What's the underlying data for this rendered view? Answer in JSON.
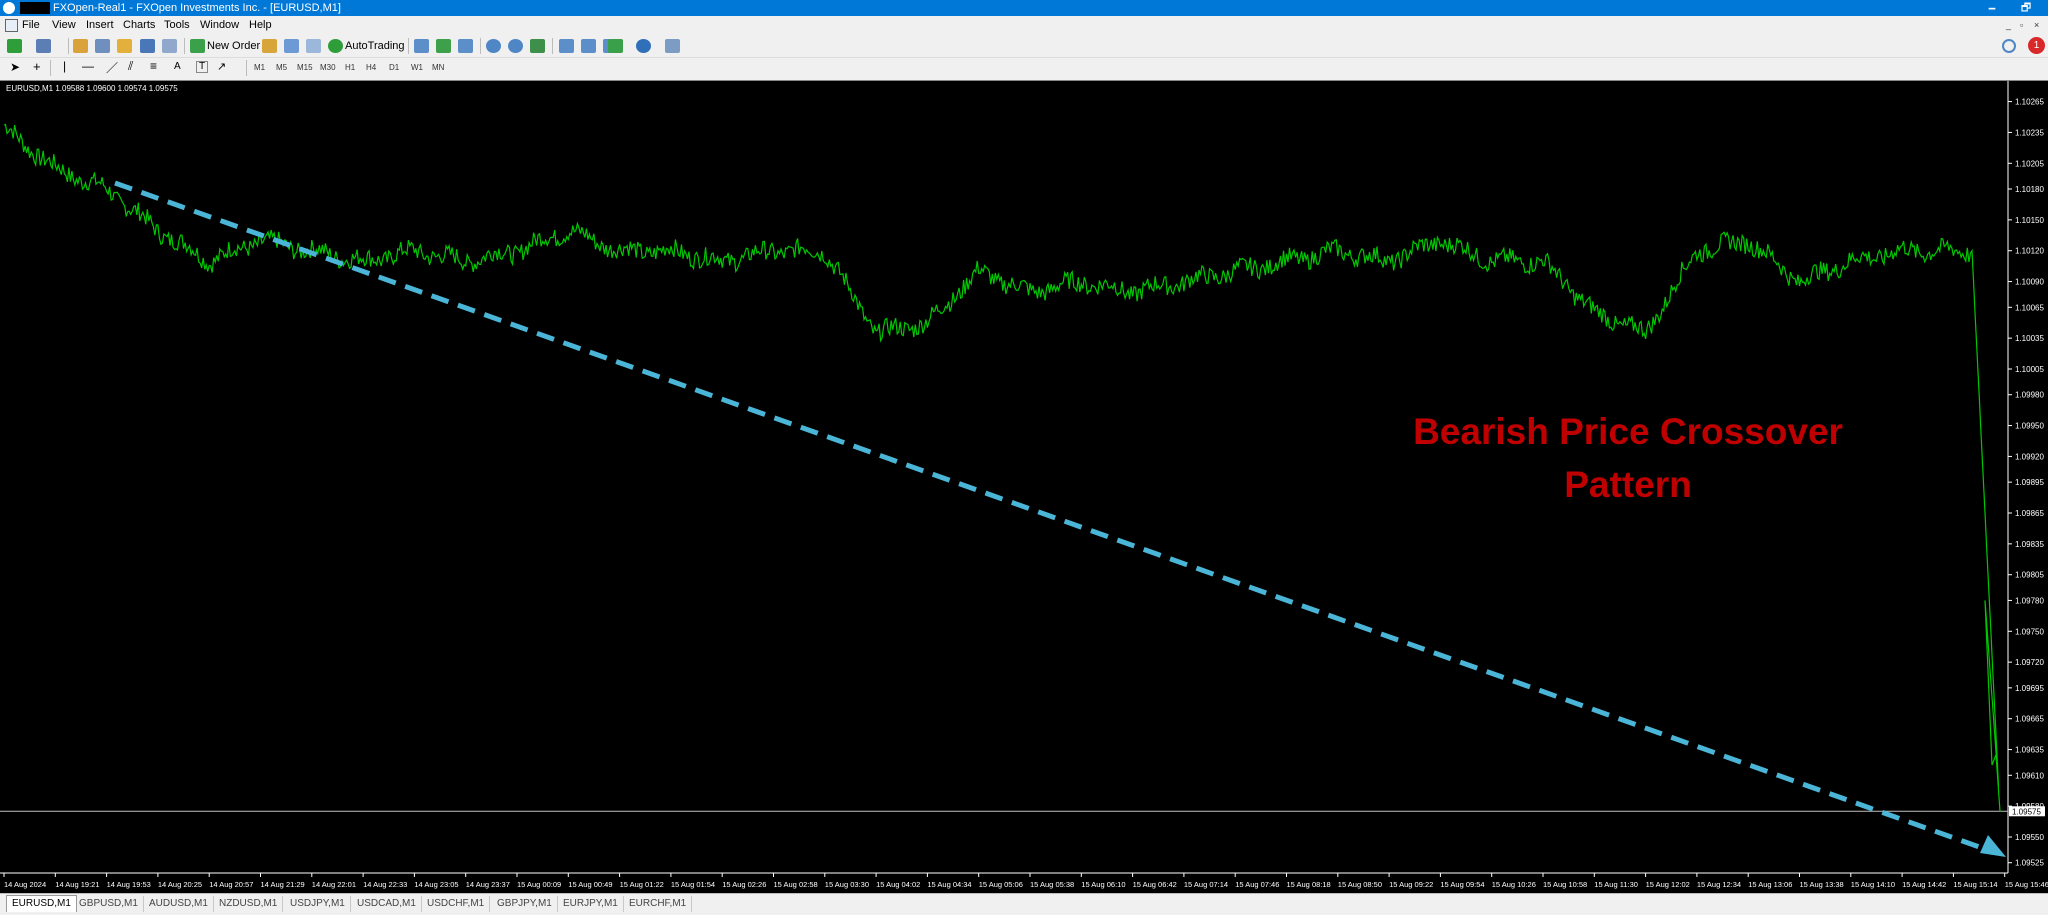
{
  "window": {
    "title": "FXOpen-Real1 - FXOpen Investments Inc. - [EURUSD,M1]",
    "controls": [
      "🗕",
      "🗗",
      "✕"
    ]
  },
  "menu": [
    "File",
    "View",
    "Insert",
    "Charts",
    "Tools",
    "Window",
    "Help"
  ],
  "mdi_controls": [
    "_",
    "▫",
    "×"
  ],
  "toolbar": {
    "new_order": "New Order",
    "autotrading": "AutoTrading",
    "notification_count": "1"
  },
  "tool_letters": [
    "A",
    "T"
  ],
  "timeframes": [
    "M1",
    "M5",
    "M15",
    "M30",
    "H1",
    "H4",
    "D1",
    "W1",
    "MN"
  ],
  "chart": {
    "header": "EURUSD,M1  1.09588 1.09600 1.09574 1.09575",
    "current_price": "1.09575",
    "annotation_lines": [
      "Bearish Price Crossover",
      "Pattern"
    ],
    "colors": {
      "background": "#000000",
      "price_line": "#00c800",
      "arrow": "#4ab5d6",
      "annotation": "#c00000",
      "axis_text": "#ffffff"
    }
  },
  "chart_data": {
    "type": "line",
    "series": [
      {
        "points": [
          [
            "14 Aug 2024",
            1.1024
          ],
          [
            "14 Aug 19:21",
            1.102
          ],
          [
            "14 Aug 19:53",
            1.1018
          ],
          [
            "14 Aug 20:25",
            1.1014
          ],
          [
            "14 Aug 20:57",
            1.1011
          ],
          [
            "14 Aug 21:29",
            1.1013
          ],
          [
            "14 Aug 22:01",
            1.1012
          ],
          [
            "14 Aug 22:33",
            1.1011
          ],
          [
            "14 Aug 23:05",
            1.1012
          ],
          [
            "14 Aug 23:37",
            1.1011
          ],
          [
            "15 Aug 00:09",
            1.1012
          ],
          [
            "15 Aug 00:49",
            1.1014
          ],
          [
            "15 Aug 01:22",
            1.1012
          ],
          [
            "15 Aug 01:54",
            1.1012
          ],
          [
            "15 Aug 02:26",
            1.1011
          ],
          [
            "15 Aug 02:58",
            1.1012
          ],
          [
            "15 Aug 03:30",
            1.1012
          ],
          [
            "15 Aug 04:02",
            1.1004
          ],
          [
            "15 Aug 04:34",
            1.1005
          ],
          [
            "15 Aug 05:06",
            1.101
          ],
          [
            "15 Aug 05:38",
            1.1008
          ],
          [
            "15 Aug 06:10",
            1.1009
          ],
          [
            "15 Aug 06:42",
            1.1008
          ],
          [
            "15 Aug 07:14",
            1.1009
          ],
          [
            "15 Aug 07:46",
            1.101
          ],
          [
            "15 Aug 08:18",
            1.1011
          ],
          [
            "15 Aug 08:50",
            1.1012
          ],
          [
            "15 Aug 09:22",
            1.1011
          ],
          [
            "15 Aug 09:54",
            1.1013
          ],
          [
            "15 Aug 10:26",
            1.1011
          ],
          [
            "15 Aug 10:58",
            1.1011
          ],
          [
            "15 Aug 11:30",
            1.1006
          ],
          [
            "15 Aug 12:02",
            1.1004
          ],
          [
            "15 Aug 12:34",
            1.1012
          ],
          [
            "15 Aug 13:06",
            1.1013
          ],
          [
            "15 Aug 13:38",
            1.1009
          ],
          [
            "15 Aug 14:10",
            1.1011
          ],
          [
            "15 Aug 14:42",
            1.1012
          ],
          [
            "15 Aug 15:14",
            1.1012
          ],
          [
            "15 Aug 15:46",
            1.0957
          ]
        ]
      }
    ],
    "y_ticks": [
      "1.10265",
      "1.10235",
      "1.10205",
      "1.10180",
      "1.10150",
      "1.10120",
      "1.10090",
      "1.10065",
      "1.10035",
      "1.10005",
      "1.09980",
      "1.09950",
      "1.09920",
      "1.09895",
      "1.09865",
      "1.09835",
      "1.09805",
      "1.09780",
      "1.09750",
      "1.09720",
      "1.09695",
      "1.09665",
      "1.09635",
      "1.09610",
      "1.09580",
      "1.09550",
      "1.09525"
    ],
    "x_ticks": [
      "14 Aug 2024",
      "14 Aug 19:21",
      "14 Aug 19:53",
      "14 Aug 20:25",
      "14 Aug 20:57",
      "14 Aug 21:29",
      "14 Aug 22:01",
      "14 Aug 22:33",
      "14 Aug 23:05",
      "14 Aug 23:37",
      "15 Aug 00:09",
      "15 Aug 00:49",
      "15 Aug 01:22",
      "15 Aug 01:54",
      "15 Aug 02:26",
      "15 Aug 02:58",
      "15 Aug 03:30",
      "15 Aug 04:02",
      "15 Aug 04:34",
      "15 Aug 05:06",
      "15 Aug 05:38",
      "15 Aug 06:10",
      "15 Aug 06:42",
      "15 Aug 07:14",
      "15 Aug 07:46",
      "15 Aug 08:18",
      "15 Aug 08:50",
      "15 Aug 09:22",
      "15 Aug 09:54",
      "15 Aug 10:26",
      "15 Aug 10:58",
      "15 Aug 11:30",
      "15 Aug 12:02",
      "15 Aug 12:34",
      "15 Aug 13:06",
      "15 Aug 13:38",
      "15 Aug 14:10",
      "15 Aug 14:42",
      "15 Aug 15:14",
      "15 Aug 15:46"
    ],
    "ylim": [
      1.09515,
      1.10285
    ],
    "grid": false
  },
  "tabs": [
    "EURUSD,M1",
    "GBPUSD,M1",
    "AUDUSD,M1",
    "NZDUSD,M1",
    "USDJPY,M1",
    "USDCAD,M1",
    "USDCHF,M1",
    "GBPJPY,M1",
    "EURJPY,M1",
    "EURCHF,M1"
  ]
}
